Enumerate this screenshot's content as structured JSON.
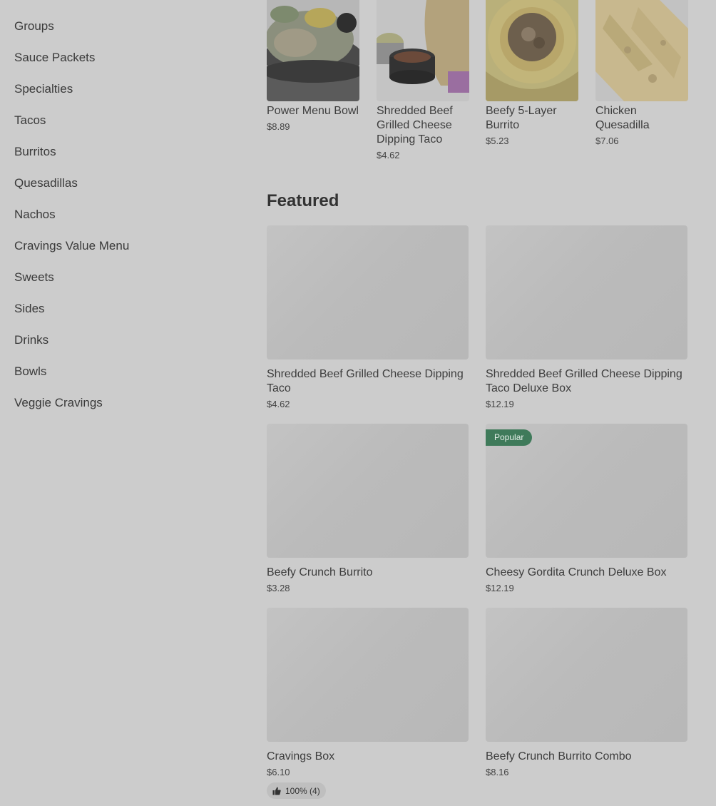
{
  "sidebar": {
    "items": [
      {
        "label": "Groups"
      },
      {
        "label": "Sauce Packets"
      },
      {
        "label": "Specialties"
      },
      {
        "label": "Tacos"
      },
      {
        "label": "Burritos"
      },
      {
        "label": "Quesadillas"
      },
      {
        "label": "Nachos"
      },
      {
        "label": "Cravings Value Menu"
      },
      {
        "label": "Sweets"
      },
      {
        "label": "Sides"
      },
      {
        "label": "Drinks"
      },
      {
        "label": "Bowls"
      },
      {
        "label": "Veggie Cravings"
      }
    ]
  },
  "carousel": {
    "items": [
      {
        "name": "Power Menu Bowl",
        "price": "$8.89",
        "image_icon": "power-menu-bowl-photo"
      },
      {
        "name": "Shredded Beef Grilled Cheese Dipping Taco",
        "price": "$4.62",
        "image_icon": "dipping-taco-photo"
      },
      {
        "name": "Beefy 5-Layer Burrito",
        "price": "$5.23",
        "image_icon": "burrito-photo"
      },
      {
        "name": "Chicken Quesadilla",
        "price": "$7.06",
        "image_icon": "quesadilla-photo"
      }
    ]
  },
  "featured": {
    "title": "Featured",
    "items": [
      {
        "name": "Shredded Beef Grilled Cheese Dipping Taco",
        "price": "$4.62"
      },
      {
        "name": "Shredded Beef Grilled Cheese Dipping Taco Deluxe Box",
        "price": "$12.19"
      },
      {
        "name": "Beefy Crunch Burrito",
        "price": "$3.28"
      },
      {
        "name": "Cheesy Gordita Crunch Deluxe Box",
        "price": "$12.19",
        "badge": "Popular"
      },
      {
        "name": "Cravings Box",
        "price": "$6.10",
        "rating": "100% (4)",
        "rating_icon": "thumbs-up-icon"
      },
      {
        "name": "Beefy Crunch Burrito Combo",
        "price": "$8.16"
      }
    ]
  },
  "colors": {
    "overlay_bg": "#cccccc",
    "badge_green": "#3f7a5a",
    "text": "#3d3d3d"
  }
}
